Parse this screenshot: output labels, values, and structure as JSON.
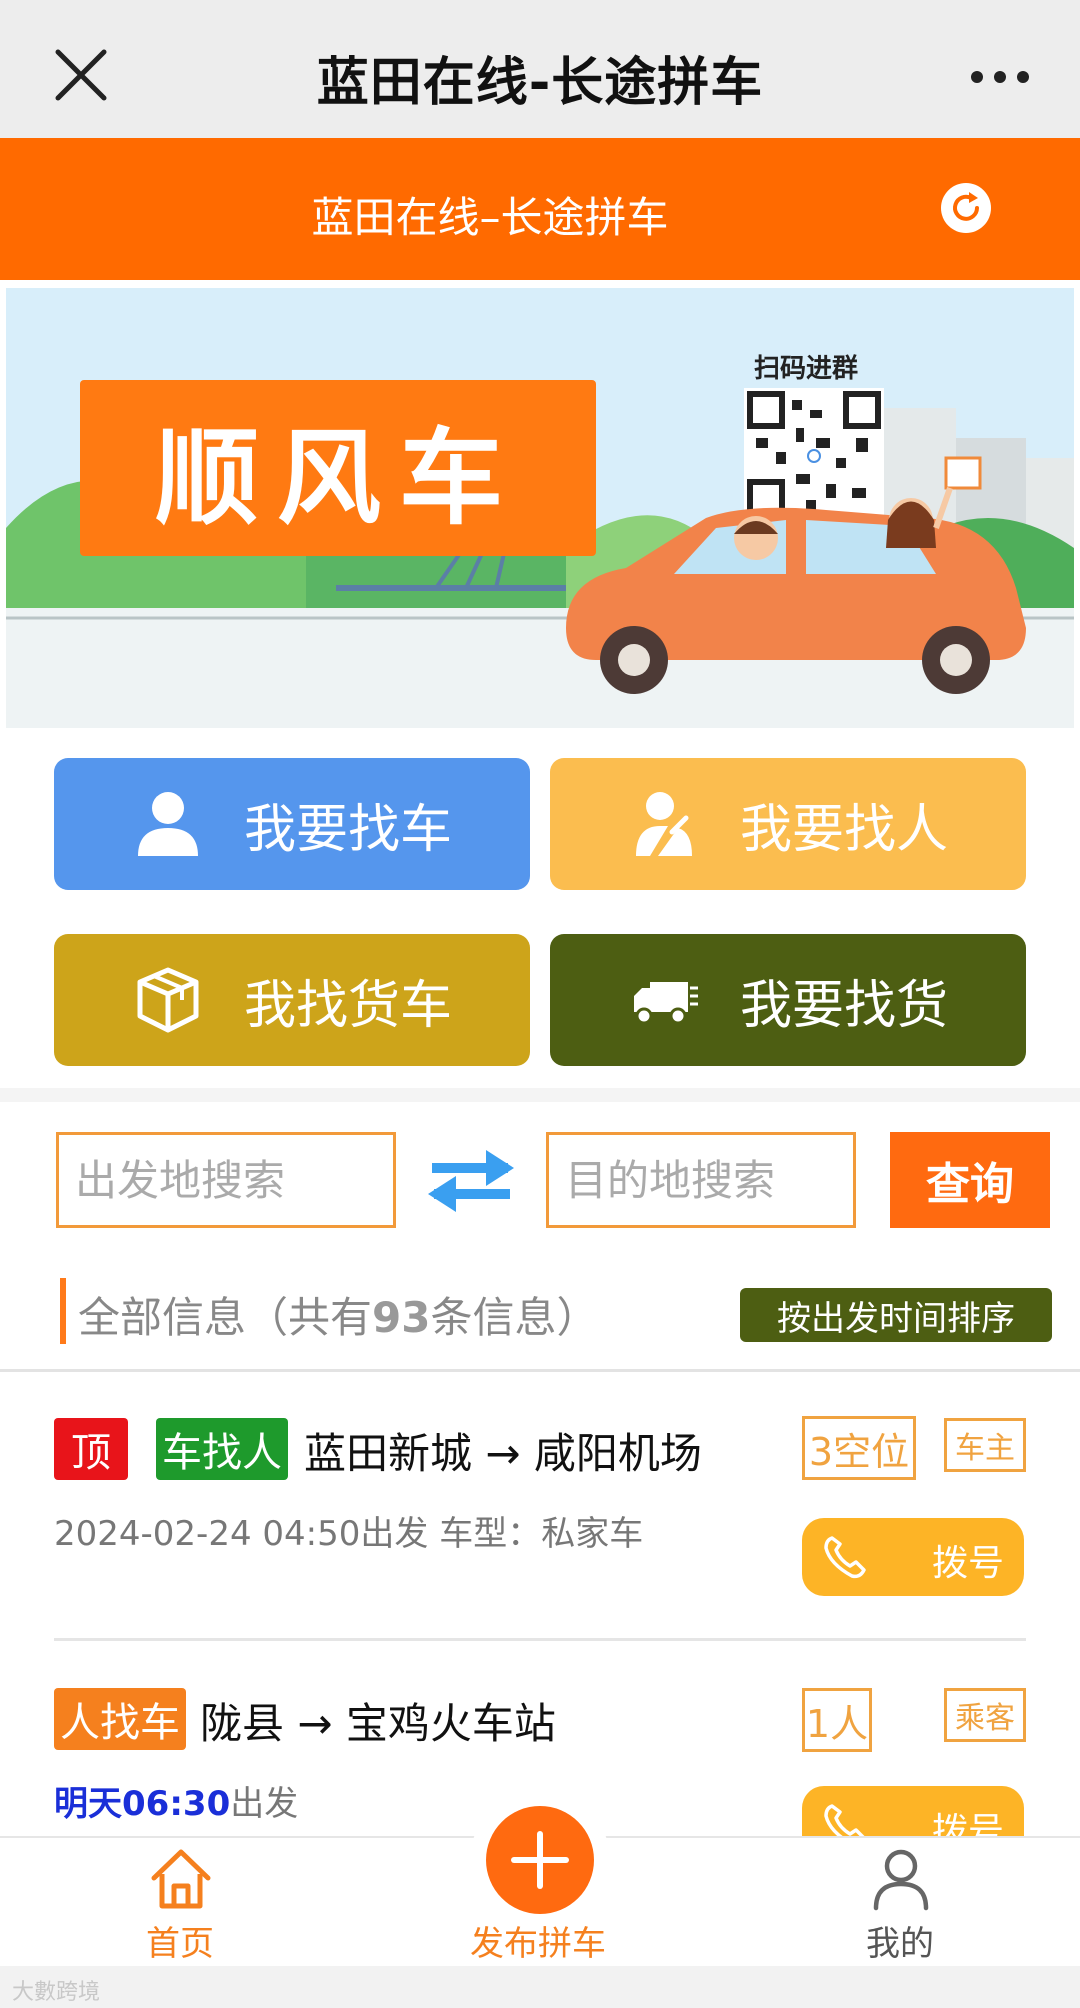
{
  "wechat_bar": {
    "title": "蓝田在线-长途拼车",
    "close_icon": "close-icon",
    "more_icon": "more-icon"
  },
  "header": {
    "title": "蓝田在线–长途拼车",
    "refresh_icon": "refresh-icon",
    "bg_color": "#ff6a00"
  },
  "banner": {
    "headline": "顺风车",
    "qr_label": "扫码进群"
  },
  "categories": [
    {
      "label": "我要找车",
      "icon": "user-icon",
      "color": "#5596ed"
    },
    {
      "label": "我要找人",
      "icon": "driver-icon",
      "color": "#fbbd4f"
    },
    {
      "label": "我找货车",
      "icon": "box-icon",
      "color": "#cda41a"
    },
    {
      "label": "我要找货",
      "icon": "truck-icon",
      "color": "#4d5e12"
    }
  ],
  "search": {
    "from_placeholder": "出发地搜索",
    "to_placeholder": "目的地搜索",
    "query_label": "查询",
    "swap_icon": "swap-icon"
  },
  "info": {
    "title_prefix": "全部信息（共有",
    "count": "93",
    "title_suffix": "条信息）",
    "sort_label": "按出发时间排序"
  },
  "listings": [
    {
      "top_tag": "顶",
      "type_tag": "车找人",
      "route": "蓝田新城 → 咸阳机场",
      "meta": "2024-02-24 04:50出发 车型：私家车",
      "seats": "3空位",
      "role": "车主",
      "dial_label": "拨号"
    },
    {
      "type_tag": "人找车",
      "route": "陇县 → 宝鸡火车站",
      "time_highlight": "明天06:30",
      "time_suffix": "出发",
      "seats": "1人",
      "role": "乘客",
      "dial_label": "拨号"
    }
  ],
  "tabbar": {
    "home": "首页",
    "post": "发布拼车",
    "mine": "我的"
  },
  "watermark": "大數跨境"
}
